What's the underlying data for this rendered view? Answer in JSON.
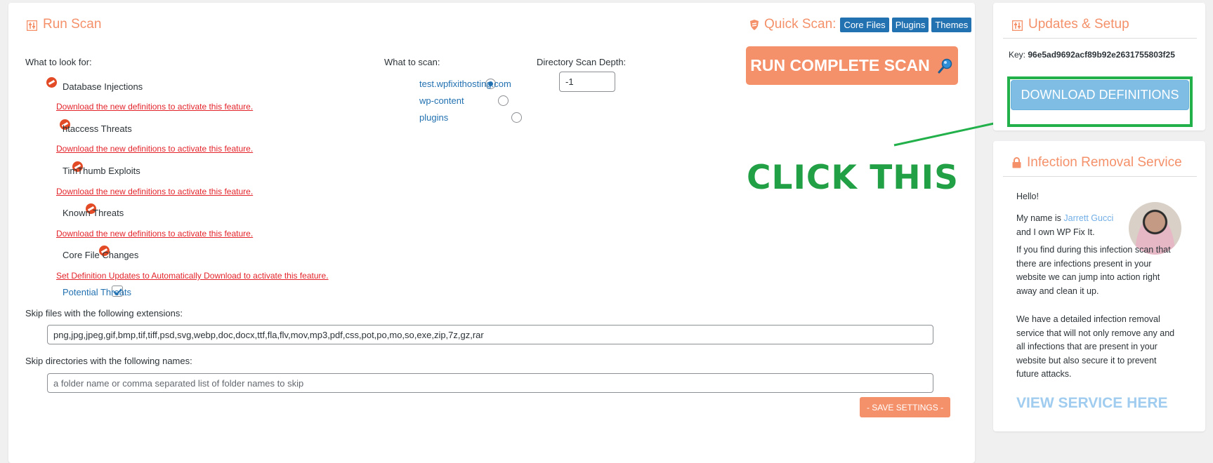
{
  "run_scan": {
    "title": "Run Scan",
    "what_to_look_for_label": "What to look for:",
    "items": [
      {
        "label": "Database Injections",
        "note": "Download the new definitions to activate this feature."
      },
      {
        "label": "htaccess Threats",
        "note": "Download the new definitions to activate this feature."
      },
      {
        "label": "TimThumb Exploits",
        "note": "Download the new definitions to activate this feature."
      },
      {
        "label": "Known Threats",
        "note": "Download the new definitions to activate this feature."
      },
      {
        "label": "Core File Changes",
        "note": "Set Definition Updates to Automatically Download to activate this feature."
      }
    ],
    "potential_threats_label": "Potential Threats",
    "potential_threats_checked": true,
    "what_to_scan_label": "What to scan:",
    "scan_options": [
      {
        "label": "test.wpfixithosting.com",
        "selected": true
      },
      {
        "label": "wp-content",
        "selected": false
      },
      {
        "label": "plugins",
        "selected": false
      }
    ],
    "depth_label": "Directory Scan Depth:",
    "depth_value": "-1",
    "quick_scan_label": "Quick Scan:",
    "quick_scan_buttons": [
      "Core Files",
      "Plugins",
      "Themes"
    ],
    "run_complete_label": "RUN COMPLETE SCAN",
    "skip_ext_label": "Skip files with the following extensions:",
    "skip_ext_value": "png,jpg,jpeg,gif,bmp,tif,tiff,psd,svg,webp,doc,docx,ttf,fla,flv,mov,mp3,pdf,css,pot,po,mo,so,exe,zip,7z,gz,rar",
    "skip_dir_label": "Skip directories with the following names:",
    "skip_dir_placeholder": "a folder name or comma separated list of folder names to skip",
    "save_label": "- SAVE SETTINGS -"
  },
  "annotation": {
    "text": "CLICK THIS",
    "color": "#22a046"
  },
  "updates": {
    "title": "Updates & Setup",
    "key_label": "Key:",
    "key_value": "96e5ad9692acf89b92e2631755803f25",
    "download_label": "DOWNLOAD DEFINITIONS"
  },
  "removal": {
    "title": "Infection Removal Service",
    "hello": "Hello!",
    "intro_prefix": "My name is ",
    "name": "Jarrett Gucci",
    "intro_suffix": "and I own WP Fix It.",
    "para1": "If you find during this infection scan that there are infections present in your website we can jump into action right away and clean it up.",
    "para2": "We have a detailed infection removal service that will not only remove any and all infections that are present in your website but also secure it to prevent future attacks.",
    "cta": "VIEW SERVICE HERE"
  },
  "colors": {
    "accent": "#f4916a",
    "link": "#2271b1",
    "warning": "#e3242b",
    "annotation_green": "#22b04b",
    "download_button": "#7fbde4"
  },
  "icons": {
    "title_icon": "settings-sliders-icon",
    "quick_scan_icon": "shield-icon",
    "run_icon": "magnifier-icon",
    "blocked_icon": "no-entry-icon",
    "lock_icon": "lock-icon"
  }
}
